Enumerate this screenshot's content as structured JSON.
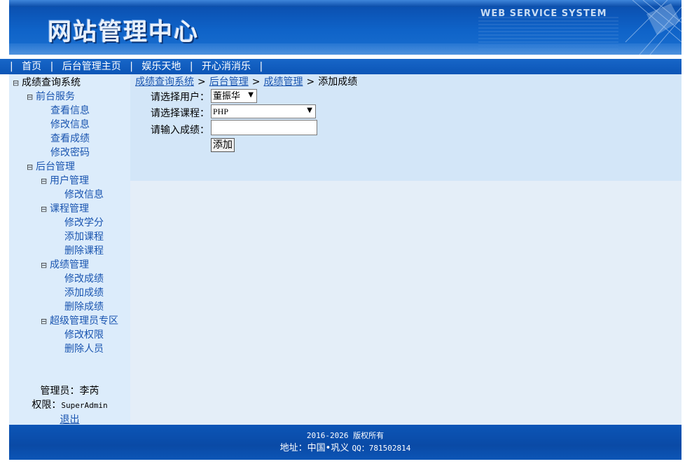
{
  "header": {
    "site_title": "网站管理中心",
    "system_name": "WEB SERVICE SYSTEM"
  },
  "nav": {
    "items": [
      {
        "label": "首页"
      },
      {
        "label": "后台管理主页"
      },
      {
        "label": "娱乐天地"
      },
      {
        "label": "开心消消乐"
      }
    ],
    "separator": "|"
  },
  "sidebar": {
    "toggle_glyph": "⊟",
    "root": "成绩查询系统",
    "front": {
      "label": "前台服务",
      "items": [
        "查看信息",
        "修改信息",
        "查看成绩",
        "修改密码"
      ]
    },
    "back": {
      "label": "后台管理",
      "groups": [
        {
          "label": "用户管理",
          "items": [
            "修改信息"
          ]
        },
        {
          "label": "课程管理",
          "items": [
            "修改学分",
            "添加课程",
            "删除课程"
          ]
        },
        {
          "label": "成绩管理",
          "items": [
            "修改成绩",
            "添加成绩",
            "删除成绩"
          ]
        },
        {
          "label": "超级管理员专区",
          "items": [
            "修改权限",
            "删除人员"
          ]
        }
      ]
    },
    "admin": {
      "name_label": "管理员：李芮",
      "role_label": "权限：",
      "role_value": "SuperAdmin",
      "logout": "退出"
    }
  },
  "breadcrumb": {
    "items": [
      "成绩查询系统",
      "后台管理",
      "成绩管理"
    ],
    "current": "添加成绩",
    "separator": ">"
  },
  "form": {
    "user_label": "请选择用户：",
    "user_value": "董振华",
    "course_label": "请选择课程：",
    "course_value": "PHP",
    "score_label": "请输入成绩：",
    "score_value": "",
    "submit_label": "添加"
  },
  "footer": {
    "copyright": "2016-2026 版权所有",
    "address_label": "地址：中国•巩义",
    "qq_label": "QQ：781502814"
  },
  "colors": {
    "header_blue": "#0c55b6",
    "sidebar_bg": "#dcecfb",
    "content_bg": "#d3e6f8",
    "link_blue": "#1a55b0"
  }
}
